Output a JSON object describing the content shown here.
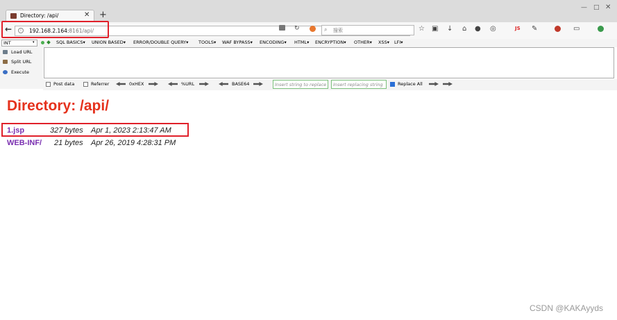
{
  "browser": {
    "tab_title": "Directory: /api/",
    "url_host": "192.168.2.164:",
    "url_port_path": "8161/api/",
    "search_placeholder": "搜索",
    "js_badge": "JS"
  },
  "hackbar": {
    "int_select": "INT",
    "menus": [
      "SQL BASICS",
      "UNION BASED",
      "ERROR/DOUBLE QUERY",
      "TOOLS",
      "WAF BYPASS",
      "ENCODING",
      "HTML",
      "ENCRYPTION",
      "OTHER",
      "XSS",
      "LFI"
    ],
    "load_url": "Load URL",
    "split_url": "Split URL",
    "execute": "Execute",
    "post_data": "Post data",
    "referrer": "Referrer",
    "hex": "0xHEX",
    "url_enc": "%URL",
    "base64": "BASE64",
    "insert_string_ph": "Insert string to replace",
    "insert_replacing_ph": "Insert replacing string",
    "replace_all": "Replace All"
  },
  "page": {
    "heading": "Directory: /api/",
    "files": [
      {
        "name": "1.jsp",
        "size": "327 bytes",
        "date": "Apr 1, 2023 2:13:47 AM"
      },
      {
        "name": "WEB-INF/",
        "size": "21 bytes",
        "date": "Apr 26, 2019 4:28:31 PM"
      }
    ]
  },
  "watermark": "CSDN @KAKAyyds",
  "colors": {
    "heading": "#e5321d",
    "link": "#7a2fb0",
    "highlight": "#e0202a"
  }
}
